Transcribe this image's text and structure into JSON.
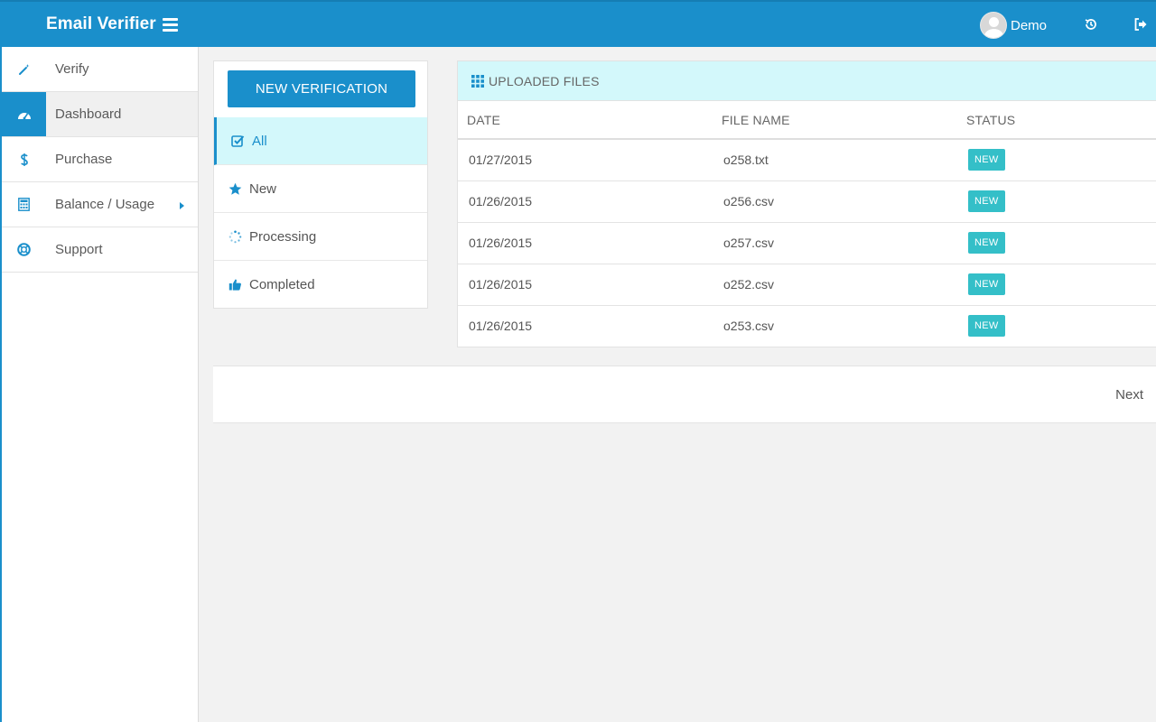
{
  "app": {
    "title": "Email Verifier",
    "user_name": "Demo"
  },
  "colors": {
    "primary": "#1a8fcb",
    "highlight": "#d3f8fb",
    "badge": "#34bfc8"
  },
  "sidebar": {
    "items": [
      {
        "label": "Verify",
        "icon": "magic-wand-icon"
      },
      {
        "label": "Dashboard",
        "icon": "dashboard-icon",
        "active": true
      },
      {
        "label": "Purchase",
        "icon": "dollar-icon"
      },
      {
        "label": "Balance / Usage",
        "icon": "calculator-icon",
        "has_submenu": true
      },
      {
        "label": "Support",
        "icon": "lifebuoy-icon"
      }
    ]
  },
  "filters": {
    "new_button": "NEW VERIFICATION",
    "items": [
      {
        "label": "All",
        "icon": "check-square-icon",
        "active": true
      },
      {
        "label": "New",
        "icon": "star-icon"
      },
      {
        "label": "Processing",
        "icon": "spinner-icon"
      },
      {
        "label": "Completed",
        "icon": "thumbs-up-icon"
      }
    ]
  },
  "files": {
    "title": "UPLOADED FILES",
    "columns": [
      "DATE",
      "FILE NAME",
      "STATUS"
    ],
    "rows": [
      {
        "date": "01/27/2015",
        "name": "o258.txt",
        "status": "NEW"
      },
      {
        "date": "01/26/2015",
        "name": "o256.csv",
        "status": "NEW"
      },
      {
        "date": "01/26/2015",
        "name": "o257.csv",
        "status": "NEW"
      },
      {
        "date": "01/26/2015",
        "name": "o252.csv",
        "status": "NEW"
      },
      {
        "date": "01/26/2015",
        "name": "o253.csv",
        "status": "NEW"
      }
    ]
  },
  "pagination": {
    "next_label": "Next"
  }
}
